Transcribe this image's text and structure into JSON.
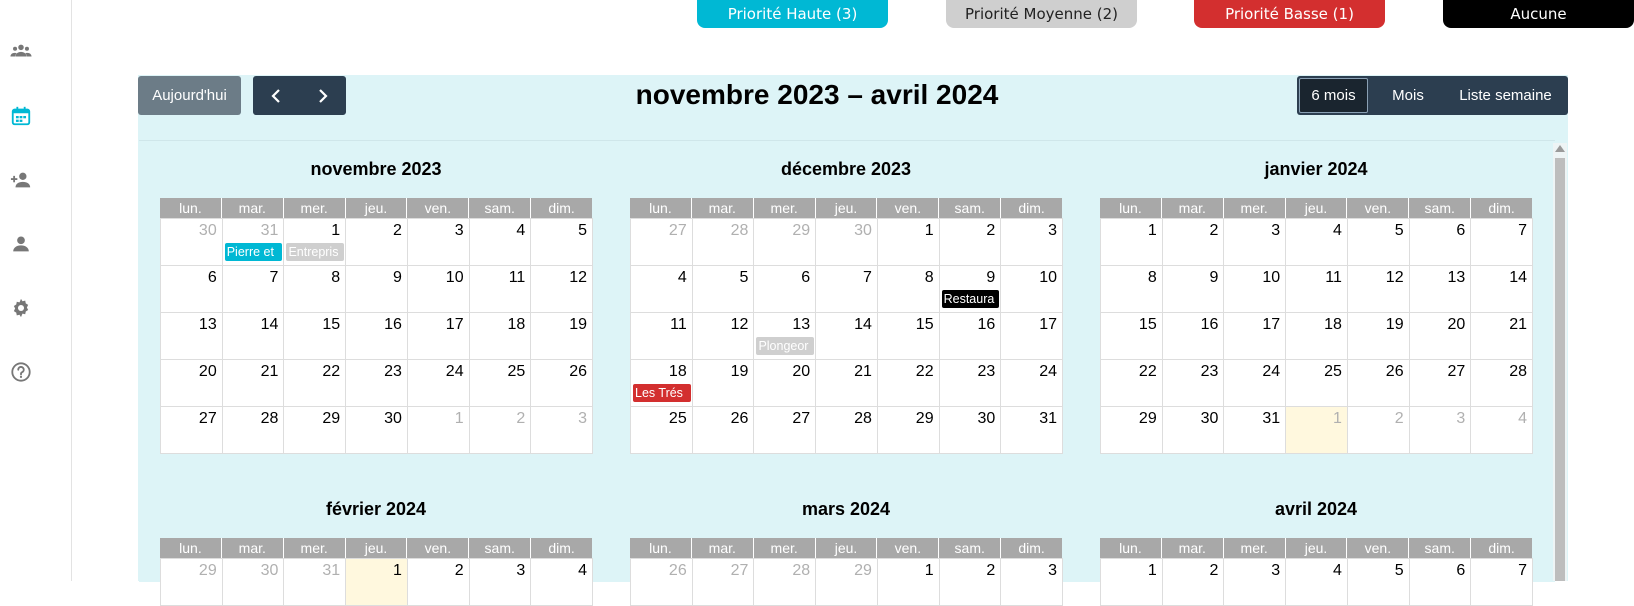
{
  "sidebar": {
    "icons": [
      "users-icon",
      "calendar-icon",
      "add-user-icon",
      "user-icon",
      "gear-icon",
      "help-icon"
    ],
    "active_color": "#00b8d4",
    "inactive_color": "#777777"
  },
  "priorities": [
    {
      "label": "Priorité Haute (3)",
      "color": "#00b8d4",
      "text_color": "#ffffff"
    },
    {
      "label": "Priorité Moyenne (2)",
      "color": "#cfcfcf",
      "text_color": "#222222"
    },
    {
      "label": "Priorité Basse (1)",
      "color": "#d32f2f",
      "text_color": "#ffffff"
    },
    {
      "label": "Aucune",
      "color": "#000000",
      "text_color": "#ffffff"
    }
  ],
  "toolbar": {
    "today_label": "Aujourd'hui",
    "prev_icon": "chevron-left-icon",
    "next_icon": "chevron-right-icon",
    "title": "novembre 2023 – avril 2024",
    "views": [
      "6 mois",
      "Mois",
      "Liste semaine"
    ],
    "active_view": "6 mois"
  },
  "dow": [
    "lun.",
    "mar.",
    "mer.",
    "jeu.",
    "ven.",
    "sam.",
    "dim."
  ],
  "months": [
    {
      "title": "novembre 2023",
      "weeks": [
        [
          {
            "d": "30",
            "o": true
          },
          {
            "d": "31",
            "o": true,
            "ev": {
              "t": "Pierre et",
              "c": "#00b8d4"
            }
          },
          {
            "d": "1",
            "ev": {
              "t": "Entrepris",
              "c": "#cfcfcf"
            }
          },
          {
            "d": "2"
          },
          {
            "d": "3"
          },
          {
            "d": "4"
          },
          {
            "d": "5"
          }
        ],
        [
          {
            "d": "6"
          },
          {
            "d": "7"
          },
          {
            "d": "8"
          },
          {
            "d": "9"
          },
          {
            "d": "10"
          },
          {
            "d": "11"
          },
          {
            "d": "12"
          }
        ],
        [
          {
            "d": "13"
          },
          {
            "d": "14"
          },
          {
            "d": "15"
          },
          {
            "d": "16"
          },
          {
            "d": "17"
          },
          {
            "d": "18"
          },
          {
            "d": "19"
          }
        ],
        [
          {
            "d": "20"
          },
          {
            "d": "21"
          },
          {
            "d": "22"
          },
          {
            "d": "23"
          },
          {
            "d": "24"
          },
          {
            "d": "25"
          },
          {
            "d": "26"
          }
        ],
        [
          {
            "d": "27"
          },
          {
            "d": "28"
          },
          {
            "d": "29"
          },
          {
            "d": "30"
          },
          {
            "d": "1",
            "o": true
          },
          {
            "d": "2",
            "o": true
          },
          {
            "d": "3",
            "o": true
          }
        ]
      ]
    },
    {
      "title": "décembre 2023",
      "weeks": [
        [
          {
            "d": "27",
            "o": true
          },
          {
            "d": "28",
            "o": true
          },
          {
            "d": "29",
            "o": true
          },
          {
            "d": "30",
            "o": true
          },
          {
            "d": "1"
          },
          {
            "d": "2"
          },
          {
            "d": "3"
          }
        ],
        [
          {
            "d": "4"
          },
          {
            "d": "5"
          },
          {
            "d": "6"
          },
          {
            "d": "7"
          },
          {
            "d": "8"
          },
          {
            "d": "9",
            "ev": {
              "t": "Restaura",
              "c": "#000000"
            }
          },
          {
            "d": "10"
          }
        ],
        [
          {
            "d": "11"
          },
          {
            "d": "12"
          },
          {
            "d": "13",
            "ev": {
              "t": "Plongeor",
              "c": "#cfcfcf"
            }
          },
          {
            "d": "14"
          },
          {
            "d": "15"
          },
          {
            "d": "16"
          },
          {
            "d": "17"
          }
        ],
        [
          {
            "d": "18",
            "ev": {
              "t": "Les Trés",
              "c": "#d32f2f"
            }
          },
          {
            "d": "19"
          },
          {
            "d": "20"
          },
          {
            "d": "21"
          },
          {
            "d": "22"
          },
          {
            "d": "23"
          },
          {
            "d": "24"
          }
        ],
        [
          {
            "d": "25"
          },
          {
            "d": "26"
          },
          {
            "d": "27"
          },
          {
            "d": "28"
          },
          {
            "d": "29"
          },
          {
            "d": "30"
          },
          {
            "d": "31"
          }
        ]
      ]
    },
    {
      "title": "janvier 2024",
      "weeks": [
        [
          {
            "d": "1"
          },
          {
            "d": "2"
          },
          {
            "d": "3"
          },
          {
            "d": "4"
          },
          {
            "d": "5"
          },
          {
            "d": "6"
          },
          {
            "d": "7"
          }
        ],
        [
          {
            "d": "8"
          },
          {
            "d": "9"
          },
          {
            "d": "10"
          },
          {
            "d": "11"
          },
          {
            "d": "12"
          },
          {
            "d": "13"
          },
          {
            "d": "14"
          }
        ],
        [
          {
            "d": "15"
          },
          {
            "d": "16"
          },
          {
            "d": "17"
          },
          {
            "d": "18"
          },
          {
            "d": "19"
          },
          {
            "d": "20"
          },
          {
            "d": "21"
          }
        ],
        [
          {
            "d": "22"
          },
          {
            "d": "23"
          },
          {
            "d": "24"
          },
          {
            "d": "25"
          },
          {
            "d": "26"
          },
          {
            "d": "27"
          },
          {
            "d": "28"
          }
        ],
        [
          {
            "d": "29"
          },
          {
            "d": "30"
          },
          {
            "d": "31"
          },
          {
            "d": "1",
            "o": true,
            "today": true
          },
          {
            "d": "2",
            "o": true
          },
          {
            "d": "3",
            "o": true
          },
          {
            "d": "4",
            "o": true
          }
        ]
      ]
    },
    {
      "title": "février 2024",
      "weeks": [
        [
          {
            "d": "29",
            "o": true
          },
          {
            "d": "30",
            "o": true
          },
          {
            "d": "31",
            "o": true
          },
          {
            "d": "1",
            "today": true
          },
          {
            "d": "2"
          },
          {
            "d": "3"
          },
          {
            "d": "4"
          }
        ]
      ]
    },
    {
      "title": "mars 2024",
      "weeks": [
        [
          {
            "d": "26",
            "o": true
          },
          {
            "d": "27",
            "o": true
          },
          {
            "d": "28",
            "o": true
          },
          {
            "d": "29",
            "o": true
          },
          {
            "d": "1"
          },
          {
            "d": "2"
          },
          {
            "d": "3"
          }
        ]
      ]
    },
    {
      "title": "avril 2024",
      "weeks": [
        [
          {
            "d": "1"
          },
          {
            "d": "2"
          },
          {
            "d": "3"
          },
          {
            "d": "4"
          },
          {
            "d": "5"
          },
          {
            "d": "6"
          },
          {
            "d": "7"
          }
        ]
      ]
    }
  ]
}
